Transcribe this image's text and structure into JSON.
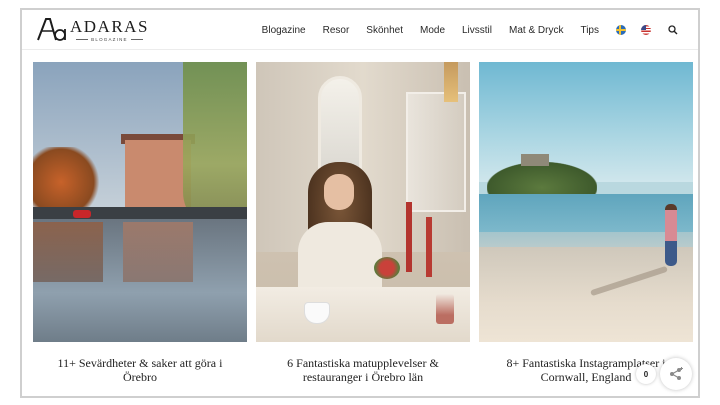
{
  "brand": {
    "name": "ADARAS",
    "tagline": "BLOGAZINE",
    "logo_icon": "adaras-monogram-icon"
  },
  "nav": {
    "items": [
      {
        "label": "Blogazine"
      },
      {
        "label": "Resor"
      },
      {
        "label": "Skönhet"
      },
      {
        "label": "Mode"
      },
      {
        "label": "Livsstil"
      },
      {
        "label": "Mat & Dryck"
      },
      {
        "label": "Tips"
      }
    ],
    "languages": [
      "swedish-flag-icon",
      "us-flag-icon"
    ],
    "search_icon": "search-icon"
  },
  "posts": [
    {
      "title": "11+ Sevärdheter & saker att göra i Örebro"
    },
    {
      "title": "6 Fantastiska matupplevelser & restauranger i Örebro län"
    },
    {
      "title": "8+ Fantastiska Instagramplatser i Cornwall, England"
    }
  ],
  "share": {
    "count": "0",
    "icon": "share-icon"
  },
  "colors": {
    "text": "#222222",
    "frame_border": "#cfcfcf",
    "header_border": "#ececec"
  }
}
